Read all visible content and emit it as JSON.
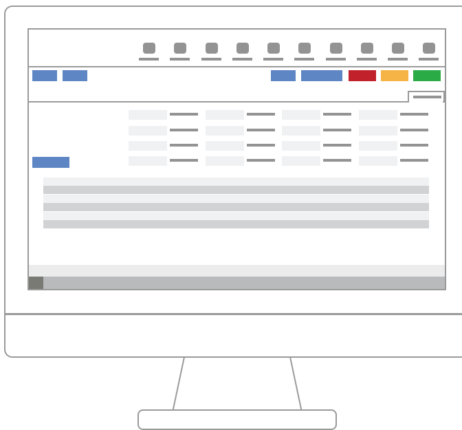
{
  "window": {
    "title": ""
  },
  "toolbar": {
    "icons": [
      "toolbar-icon-1",
      "toolbar-icon-2",
      "toolbar-icon-3",
      "toolbar-icon-4",
      "toolbar-icon-5",
      "toolbar-icon-6",
      "toolbar-icon-7",
      "toolbar-icon-8",
      "toolbar-icon-9",
      "toolbar-icon-10"
    ],
    "labels": [
      "",
      "",
      "",
      "",
      "",
      "",
      "",
      "",
      "",
      ""
    ]
  },
  "action_bar": {
    "left_buttons": [
      "",
      ""
    ],
    "right_buttons": [
      "",
      ""
    ],
    "delete_label": "",
    "warning_label": "",
    "confirm_label": ""
  },
  "tab": {
    "label": ""
  },
  "form": {
    "side_button_label": "",
    "rows": [
      [
        "",
        "",
        "",
        ""
      ],
      [
        "",
        "",
        "",
        ""
      ],
      [
        "",
        "",
        "",
        ""
      ],
      [
        "",
        "",
        "",
        ""
      ]
    ]
  },
  "table": {
    "rows": [
      "",
      "",
      "",
      "",
      "",
      ""
    ]
  },
  "colors": {
    "primary": "#5f86c4",
    "danger": "#c0212a",
    "warning": "#f7b446",
    "success": "#2bab45",
    "frame": "#9a9a9a",
    "placeholder": "#939393"
  }
}
